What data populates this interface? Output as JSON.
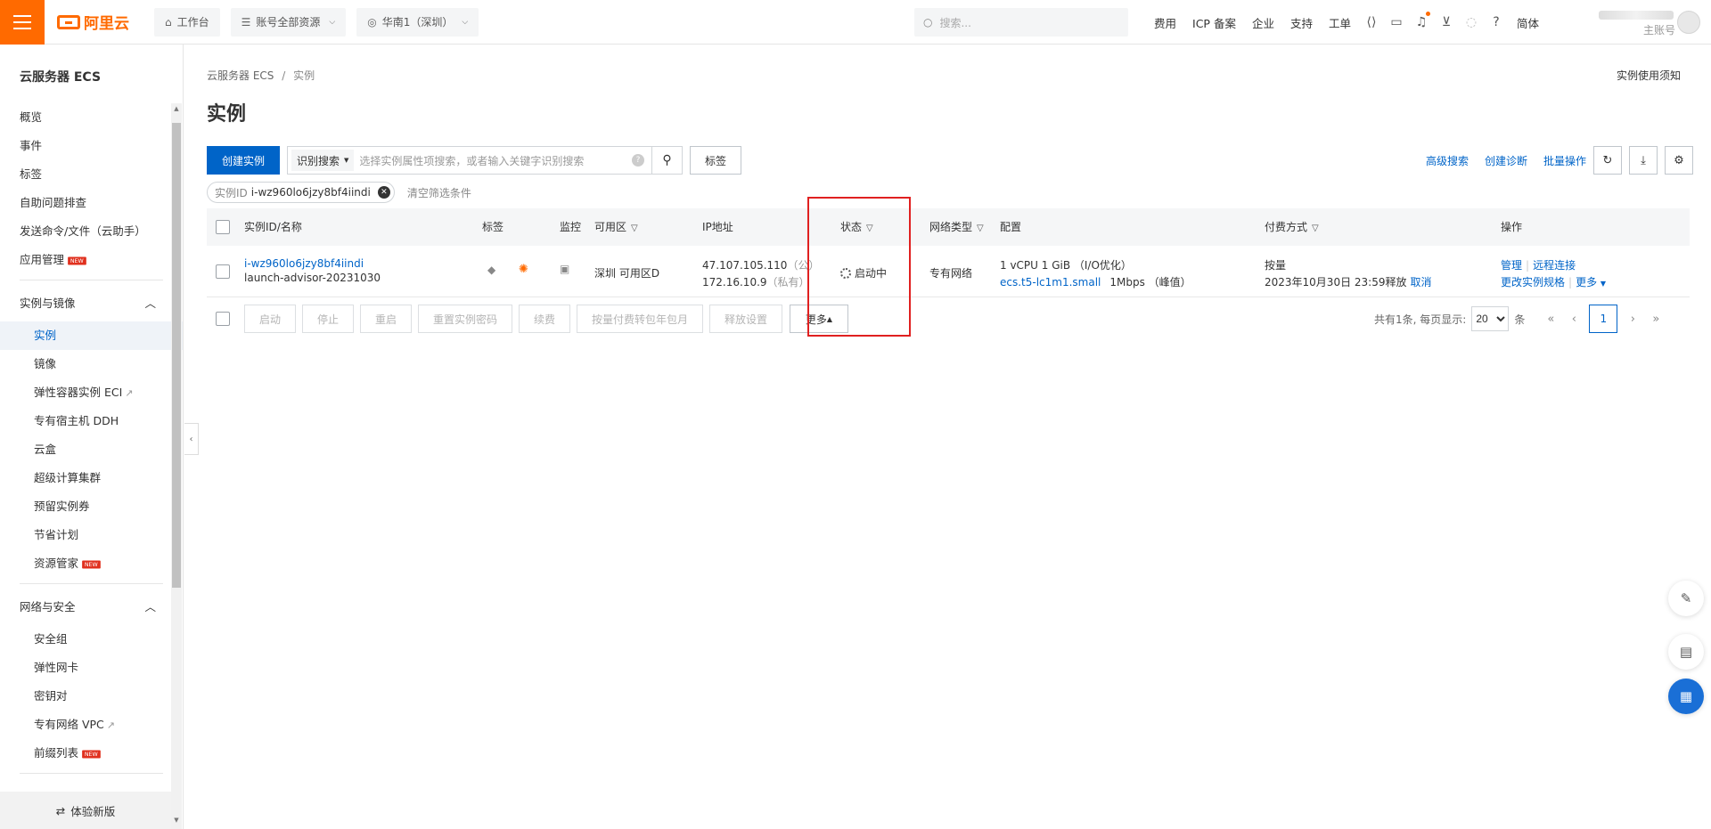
{
  "topbar": {
    "logo_text": "阿里云",
    "workbench": "工作台",
    "resources": "账号全部资源",
    "region": "华南1（深圳）",
    "search_placeholder": "搜索...",
    "links": [
      "费用",
      "ICP 备案",
      "企业",
      "支持",
      "工单"
    ],
    "lang": "简体",
    "account_label": "主账号"
  },
  "sidebar": {
    "title": "云服务器 ECS",
    "items_top": [
      "概览",
      "事件",
      "标签",
      "自助问题排查",
      "发送命令/文件（云助手）",
      "应用管理"
    ],
    "group1": "实例与镜像",
    "group1_items": [
      "实例",
      "镜像",
      "弹性容器实例 ECI",
      "专有宿主机 DDH",
      "云盒",
      "超级计算集群",
      "预留实例券",
      "节省计划",
      "资源管家"
    ],
    "group2": "网络与安全",
    "group2_items": [
      "安全组",
      "弹性网卡",
      "密钥对",
      "专有网络 VPC",
      "前缀列表"
    ],
    "new_badge": "NEW",
    "footer": "体验新版"
  },
  "main": {
    "breadcrumb_root": "云服务器 ECS",
    "breadcrumb_sep": "/",
    "breadcrumb_current": "实例",
    "notice": "实例使用须知",
    "title": "实例",
    "create_btn": "创建实例",
    "search_type": "识别搜索",
    "search_placeholder": "选择实例属性项搜索，或者输入关键字识别搜索",
    "tag_btn": "标签",
    "right_links": [
      "高级搜索",
      "创建诊断",
      "批量操作"
    ],
    "filter_key": "实例ID",
    "filter_value": "i-wz960lo6jzy8bf4iindi",
    "clear_filter": "清空筛选条件"
  },
  "table": {
    "headers": {
      "id": "实例ID/名称",
      "tag": "标签",
      "monitor": "监控",
      "zone": "可用区",
      "ip": "IP地址",
      "status": "状态",
      "network": "网络类型",
      "config": "配置",
      "billing": "付费方式",
      "ops": "操作"
    },
    "row": {
      "id": "i-wz960lo6jzy8bf4iindi",
      "name": "launch-advisor-20231030",
      "zone": "深圳 可用区D",
      "ip_public": "47.107.105.110",
      "ip_public_label": "（公）",
      "ip_private": "172.16.10.9",
      "ip_private_label": "（私有）",
      "status": "启动中",
      "network": "专有网络",
      "config_line1": "1 vCPU 1 GiB （I/O优化）",
      "config_type": "ecs.t5-lc1m1.small",
      "config_bw": "1Mbps （峰值）",
      "billing": "按量",
      "release": "2023年10月30日 23:59释放",
      "cancel": "取消",
      "op_manage": "管理",
      "op_remote": "远程连接",
      "op_spec": "更改实例规格",
      "op_more": "更多"
    }
  },
  "batch": {
    "buttons": [
      "启动",
      "停止",
      "重启",
      "重置实例密码",
      "续费",
      "按量付费转包年包月",
      "释放设置"
    ],
    "more": "更多"
  },
  "pager": {
    "total_text": "共有1条, 每页显示:",
    "page_size": "20",
    "unit": "条",
    "current": "1"
  }
}
